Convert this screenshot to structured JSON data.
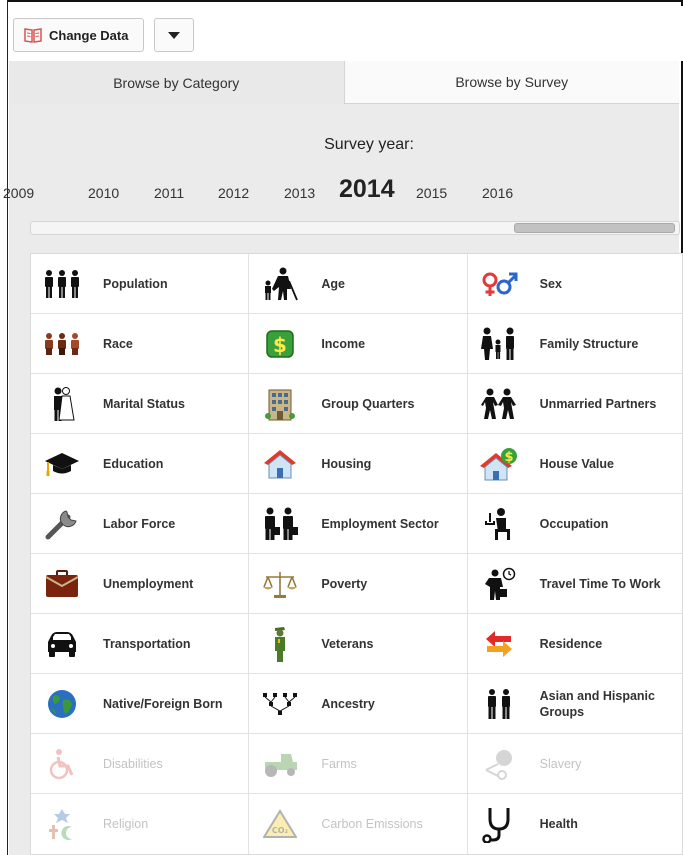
{
  "toolbar": {
    "change_data_label": "Change Data"
  },
  "tabs": [
    {
      "label": "Browse by Category",
      "active": true
    },
    {
      "label": "Browse by Survey",
      "active": false
    }
  ],
  "survey": {
    "label": "Survey year:",
    "years": [
      "2009",
      "2010",
      "2011",
      "2012",
      "2013",
      "2014",
      "2015",
      "2016"
    ],
    "selected": "2014"
  },
  "categories": [
    [
      {
        "label": "Population",
        "icon": "population-icon",
        "enabled": true
      },
      {
        "label": "Age",
        "icon": "age-icon",
        "enabled": true
      },
      {
        "label": "Sex",
        "icon": "sex-icon",
        "enabled": true
      }
    ],
    [
      {
        "label": "Race",
        "icon": "race-icon",
        "enabled": true
      },
      {
        "label": "Income",
        "icon": "dollar-icon",
        "enabled": true
      },
      {
        "label": "Family Structure",
        "icon": "family-icon",
        "enabled": true
      }
    ],
    [
      {
        "label": "Marital Status",
        "icon": "wedding-couple-icon",
        "enabled": true
      },
      {
        "label": "Group Quarters",
        "icon": "building-icon",
        "enabled": true
      },
      {
        "label": "Unmarried Partners",
        "icon": "partners-icon",
        "enabled": true
      }
    ],
    [
      {
        "label": "Education",
        "icon": "graduation-cap-icon",
        "enabled": true
      },
      {
        "label": "Housing",
        "icon": "house-icon",
        "enabled": true
      },
      {
        "label": "House Value",
        "icon": "house-value-icon",
        "enabled": true
      }
    ],
    [
      {
        "label": "Labor Force",
        "icon": "wrench-icon",
        "enabled": true
      },
      {
        "label": "Employment Sector",
        "icon": "workers-icon",
        "enabled": true
      },
      {
        "label": "Occupation",
        "icon": "office-worker-icon",
        "enabled": true
      }
    ],
    [
      {
        "label": "Unemployment",
        "icon": "briefcase-icon",
        "enabled": true
      },
      {
        "label": "Poverty",
        "icon": "scales-icon",
        "enabled": true
      },
      {
        "label": "Travel Time To Work",
        "icon": "commuter-clock-icon",
        "enabled": true
      }
    ],
    [
      {
        "label": "Transportation",
        "icon": "car-icon",
        "enabled": true
      },
      {
        "label": "Veterans",
        "icon": "soldier-icon",
        "enabled": true
      },
      {
        "label": "Residence",
        "icon": "arrows-icon",
        "enabled": true
      }
    ],
    [
      {
        "label": "Native/Foreign Born",
        "icon": "globe-icon",
        "enabled": true
      },
      {
        "label": "Ancestry",
        "icon": "family-tree-icon",
        "enabled": true
      },
      {
        "label": "Asian and Hispanic Groups",
        "icon": "people-pair-icon",
        "enabled": true
      }
    ],
    [
      {
        "label": "Disabilities",
        "icon": "wheelchair-icon",
        "enabled": false
      },
      {
        "label": "Farms",
        "icon": "tractor-icon",
        "enabled": false
      },
      {
        "label": "Slavery",
        "icon": "shackle-icon",
        "enabled": false
      }
    ],
    [
      {
        "label": "Religion",
        "icon": "religion-symbols-icon",
        "enabled": false
      },
      {
        "label": "Carbon Emissions",
        "icon": "co2-warning-icon",
        "enabled": false
      },
      {
        "label": "Health",
        "icon": "stethoscope-icon",
        "enabled": true
      }
    ]
  ]
}
